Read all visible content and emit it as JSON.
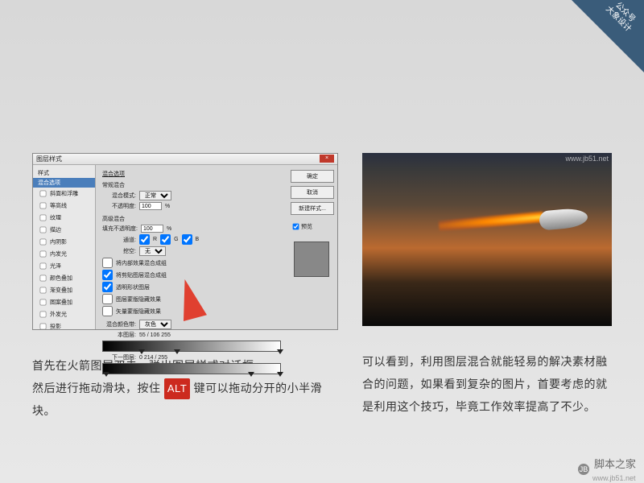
{
  "badge": {
    "line1": "公众号",
    "line2": "大象设计"
  },
  "dialog": {
    "title": "图层样式",
    "close": "×",
    "sidebar_header": "样式",
    "selected": "混合选项",
    "items": [
      "斜面和浮雕",
      "等高线",
      "纹理",
      "描边",
      "内阴影",
      "内发光",
      "光泽",
      "颜色叠加",
      "渐变叠加",
      "图案叠加",
      "外发光",
      "投影"
    ],
    "buttons": {
      "ok": "确定",
      "cancel": "取消",
      "new_style": "新建样式..."
    },
    "preview_label": "预览",
    "sections": {
      "blend_options": "混合选项",
      "general": "常规混合",
      "mode_label": "混合模式:",
      "mode_value": "正常",
      "opacity_label": "不透明度:",
      "opacity_value": "100",
      "percent": "%",
      "advanced": "高级混合",
      "fill_label": "填充不透明度:",
      "fill_value": "100",
      "channels_label": "通道:",
      "ch_r": "R",
      "ch_g": "G",
      "ch_b": "B",
      "knockout_label": "挖空:",
      "knockout_value": "无",
      "cb1": "将内部效果混合成组",
      "cb2": "将剪贴图层混合成组",
      "cb3": "透明形状图层",
      "cb4": "图层蒙版隐藏效果",
      "cb5": "矢量蒙版隐藏效果",
      "blend_if": "混合颜色带:",
      "blend_if_value": "灰色",
      "this_layer": "本图层:",
      "this_vals": "55 / 106   255",
      "under_layer": "下一图层:",
      "under_vals": "0   214 / 255"
    }
  },
  "photo": {
    "watermark": "www.jb51.net"
  },
  "captions": {
    "left_a": "首先在火箭图层双击，弹出图层样式对话框，",
    "left_b": "然后进行拖动滑块，按住 ",
    "left_alt": "ALT",
    "left_c": " 键可以拖动分开的小半滑块。",
    "right": "可以看到，利用图层混合就能轻易的解决素材融合的问题，如果看到复杂的图片，首要考虑的就是利用这个技巧，毕竟工作效率提高了不少。"
  },
  "footer": {
    "logo": "JB",
    "name": "脚本之家",
    "url": "www.jb51.net"
  }
}
